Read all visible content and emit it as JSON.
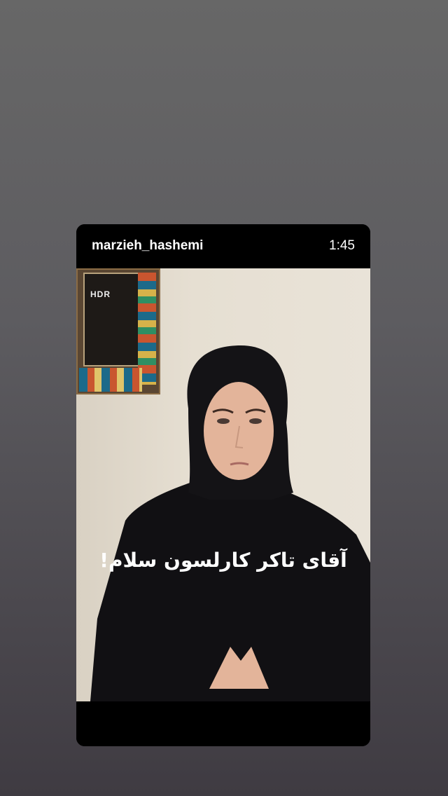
{
  "story": {
    "username": "marzieh_hashemi",
    "duration": "1:45",
    "badge": "HDR",
    "caption": "آقای تاکر کارلسون سلام!"
  }
}
